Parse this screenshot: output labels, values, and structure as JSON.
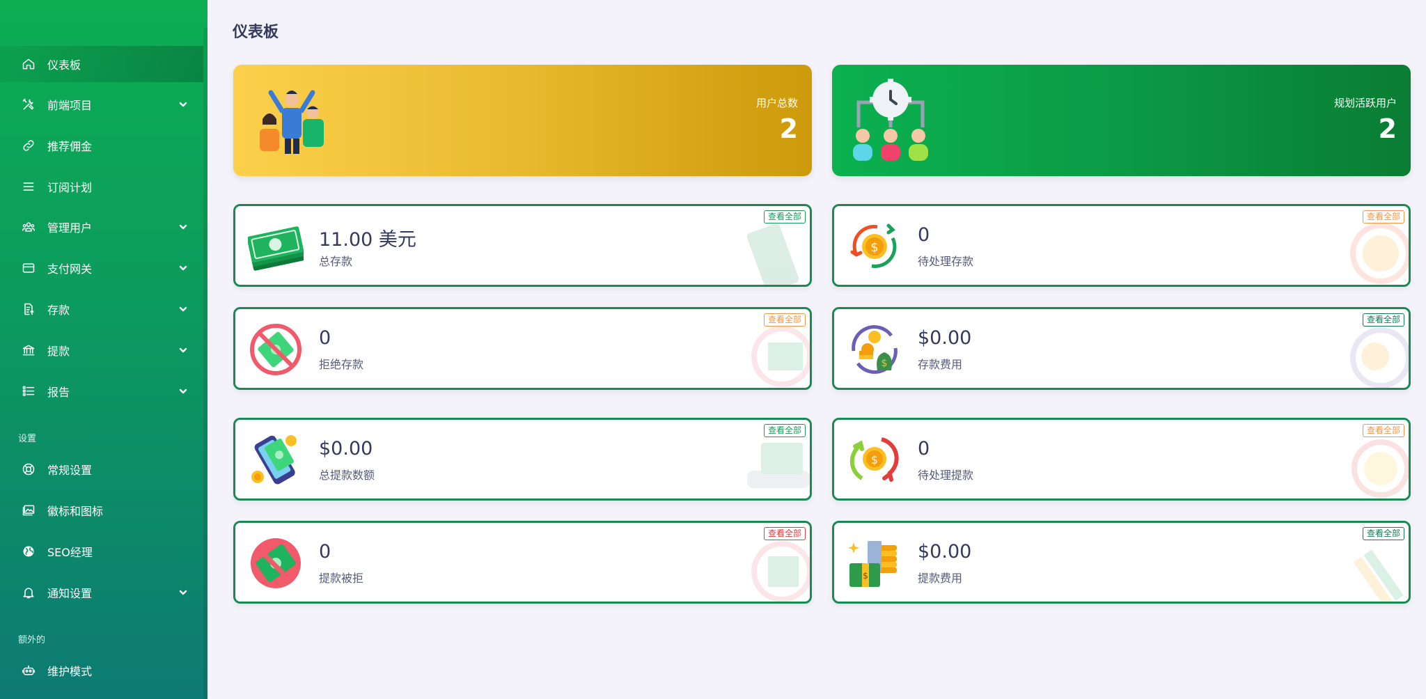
{
  "sidebar": {
    "items": [
      {
        "label": "仪表板",
        "icon": "home-icon"
      },
      {
        "label": "前端项目",
        "icon": "tools-icon"
      },
      {
        "label": "推荐佣金",
        "icon": "link-icon"
      },
      {
        "label": "订阅计划",
        "icon": "list-icon"
      },
      {
        "label": "管理用户",
        "icon": "users-icon"
      },
      {
        "label": "支付网关",
        "icon": "credit-card-icon"
      },
      {
        "label": "存款",
        "icon": "deposit-icon"
      },
      {
        "label": "提款",
        "icon": "bank-icon"
      },
      {
        "label": "报告",
        "icon": "report-list-icon"
      }
    ],
    "section_settings": "设置",
    "settings_items": [
      {
        "label": "常规设置",
        "icon": "lifebuoy-icon"
      },
      {
        "label": "徽标和图标",
        "icon": "images-icon"
      },
      {
        "label": "SEO经理",
        "icon": "globe-icon"
      },
      {
        "label": "通知设置",
        "icon": "bell-icon"
      }
    ],
    "section_extra": "额外的",
    "extra_items": [
      {
        "label": "维护模式",
        "icon": "robot-icon"
      }
    ]
  },
  "page": {
    "title": "仪表板"
  },
  "hero": {
    "users": {
      "label": "用户总数",
      "value": "2"
    },
    "active": {
      "label": "规划活跃用户",
      "value": "2"
    }
  },
  "cards": [
    {
      "value": "11.00 美元",
      "caption": "总存款",
      "view_all": "查看全部",
      "accent": "#1a9a5a"
    },
    {
      "value": "0",
      "caption": "待处理存款",
      "view_all": "查看全部",
      "accent": "#f0974a"
    },
    {
      "value": "0",
      "caption": "拒绝存款",
      "view_all": "查看全部",
      "accent": "#f0974a"
    },
    {
      "value": "$0.00",
      "caption": "存款费用",
      "view_all": "查看全部",
      "accent": "#157a5a"
    },
    {
      "value": "$0.00",
      "caption": "总提款数额",
      "view_all": "查看全部",
      "accent": "#1a9a5a"
    },
    {
      "value": "0",
      "caption": "待处理提款",
      "view_all": "查看全部",
      "accent": "#f0974a"
    },
    {
      "value": "0",
      "caption": "提款被拒",
      "view_all": "查看全部",
      "accent": "#e23c3c"
    },
    {
      "value": "$0.00",
      "caption": "提款费用",
      "view_all": "查看全部",
      "accent": "#157a5a"
    }
  ]
}
